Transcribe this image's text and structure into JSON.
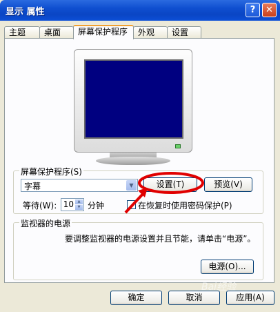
{
  "window": {
    "title": "显示 属性",
    "help_glyph": "?",
    "close_glyph": "✕"
  },
  "tabs": [
    {
      "label": "主题"
    },
    {
      "label": "桌面"
    },
    {
      "label": "屏幕保护程序",
      "active": true
    },
    {
      "label": "外观"
    },
    {
      "label": "设置"
    }
  ],
  "screensaver_group": {
    "title": "屏幕保护程序(S)",
    "selected": "字幕",
    "settings_button": "设置(T)",
    "preview_button": "预览(V)",
    "wait_label": "等待(W):",
    "wait_value": "10",
    "minutes_label": "分钟",
    "password_checkbox": "在恢复时使用密码保护(P)",
    "password_checked": false
  },
  "power_group": {
    "title": "监视器的电源",
    "description": "要调整监视器的电源设置并且节能，请单击“电源”。",
    "power_button": "电源(O)..."
  },
  "footer": {
    "ok": "确定",
    "cancel": "取消",
    "apply": "应用(A)"
  },
  "watermark": {
    "text": "Bai经验"
  },
  "colors": {
    "screen": "#000080",
    "title_bar": "#0a45c4",
    "annotation": "#e00000"
  }
}
